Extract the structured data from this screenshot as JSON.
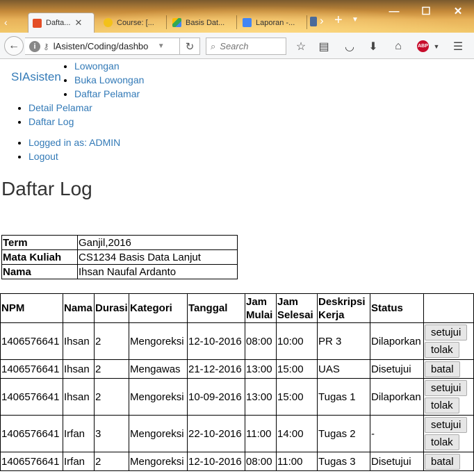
{
  "browser": {
    "tabs": [
      {
        "title": "Dafta...",
        "favicon_color": "#e44d26",
        "active": true
      },
      {
        "title": "Course: [...",
        "favicon_color": "#f3c11a",
        "active": false
      },
      {
        "title": "Basis Dat...",
        "favicon_color": "#34a853",
        "active": false
      },
      {
        "title": "Laporan -...",
        "favicon_color": "#4285f4",
        "active": false
      }
    ],
    "url": "lAsisten/Coding/dashbo",
    "search_placeholder": "Search"
  },
  "nav": {
    "brand": "SIAsisten",
    "menu_main": [
      "Lowongan",
      "Buka Lowongan",
      "Daftar Pelamar"
    ],
    "menu_extra": [
      "Detail Pelamar",
      "Daftar Log"
    ],
    "menu_user": [
      "Logged in as: ADMIN",
      "Logout"
    ]
  },
  "page": {
    "title": "Daftar Log"
  },
  "info": [
    {
      "key": "Term",
      "value": "Ganjil,2016"
    },
    {
      "key": "Mata Kuliah",
      "value": "CS1234 Basis Data Lanjut"
    },
    {
      "key": "Nama",
      "value": "Ihsan Naufal Ardanto"
    }
  ],
  "log": {
    "headers": [
      "NPM",
      "Nama",
      "Durasi",
      "Kategori",
      "Tanggal",
      "Jam Mulai",
      "Jam Selesai",
      "Deskripsi Kerja",
      "Status",
      ""
    ],
    "rows": [
      {
        "npm": "1406576641",
        "nama": "Ihsan",
        "durasi": "2",
        "kategori": "Mengoreksi",
        "tanggal": "12-10-2016",
        "mulai": "08:00",
        "selesai": "10:00",
        "deskripsi": "PR 3",
        "status": "Dilaporkan",
        "actions": [
          "setujui",
          "tolak"
        ]
      },
      {
        "npm": "1406576641",
        "nama": "Ihsan",
        "durasi": "2",
        "kategori": "Mengawas",
        "tanggal": "21-12-2016",
        "mulai": "13:00",
        "selesai": "15:00",
        "deskripsi": "UAS",
        "status": "Disetujui",
        "actions": [
          "batal"
        ]
      },
      {
        "npm": "1406576641",
        "nama": "Ihsan",
        "durasi": "2",
        "kategori": "Mengoreksi",
        "tanggal": "10-09-2016",
        "mulai": "13:00",
        "selesai": "15:00",
        "deskripsi": "Tugas 1",
        "status": "Dilaporkan",
        "actions": [
          "setujui",
          "tolak"
        ]
      },
      {
        "npm": "1406576641",
        "nama": "Irfan",
        "durasi": "3",
        "kategori": "Mengoreksi",
        "tanggal": "22-10-2016",
        "mulai": "11:00",
        "selesai": "14:00",
        "deskripsi": "Tugas 2",
        "status": "-",
        "actions": [
          "setujui",
          "tolak"
        ]
      },
      {
        "npm": "1406576641",
        "nama": "Irfan",
        "durasi": "2",
        "kategori": "Mengoreksi",
        "tanggal": "12-10-2016",
        "mulai": "08:00",
        "selesai": "11:00",
        "deskripsi": "Tugas 3",
        "status": "Disetujui",
        "actions": [
          "batal"
        ]
      }
    ]
  }
}
